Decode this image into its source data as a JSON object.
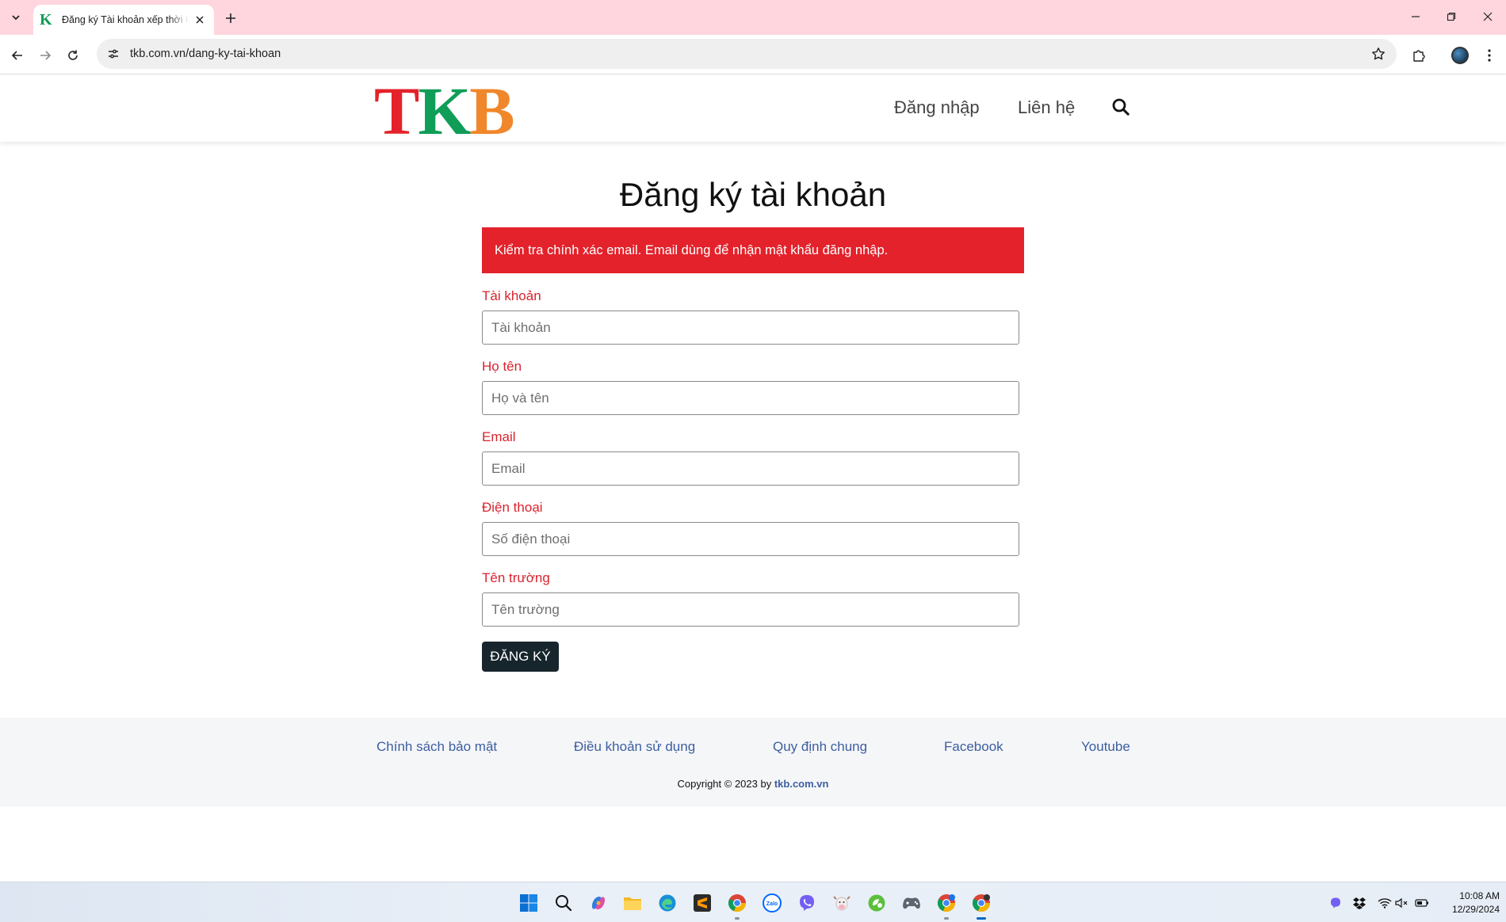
{
  "browser": {
    "tab_title": "Đăng ký Tài khoản xếp thời khóa biểu",
    "url": "tkb.com.vn/dang-ky-tai-khoan"
  },
  "site": {
    "logo": {
      "letters": [
        "T",
        "K",
        "B"
      ],
      "colors": [
        "#e3222b",
        "#0f9d58",
        "#f0872a"
      ]
    },
    "nav": {
      "login": "Đăng nhập",
      "contact": "Liên hệ"
    }
  },
  "form": {
    "title": "Đăng ký tài khoản",
    "alert": "Kiểm tra chính xác email. Email dùng để nhận mật khẩu đăng nhập.",
    "fields": [
      {
        "label": "Tài khoản",
        "placeholder": "Tài khoản",
        "value": ""
      },
      {
        "label": "Họ tên",
        "placeholder": "Họ và tên",
        "value": ""
      },
      {
        "label": "Email",
        "placeholder": "Email",
        "value": ""
      },
      {
        "label": "Điện thoại",
        "placeholder": "Số điện thoại",
        "value": ""
      },
      {
        "label": "Tên trường",
        "placeholder": "Tên trường",
        "value": ""
      }
    ],
    "submit": "ĐĂNG KÝ"
  },
  "footer": {
    "links": [
      "Chính sách bảo mật",
      "Điều khoản sử dụng",
      "Quy định chung",
      "Facebook",
      "Youtube"
    ],
    "copyright_prefix": "Copyright © 2023 by",
    "copyright_link": "tkb.com.vn"
  },
  "taskbar": {
    "apps": [
      "windows-start",
      "search",
      "copilot",
      "file-explorer",
      "edge",
      "sublime-text",
      "chrome",
      "zalo",
      "viber",
      "cow-app",
      "evernote-like",
      "game-controller",
      "chrome-profile-g",
      "chrome-active"
    ],
    "time": "10:08 AM",
    "date": "12/29/2024"
  },
  "colors": {
    "accent_red": "#e3222b",
    "label_red": "#d9232e",
    "button_dark": "#17252c",
    "footer_link": "#3d5ea0",
    "tab_bar": "#ffd6dd"
  }
}
